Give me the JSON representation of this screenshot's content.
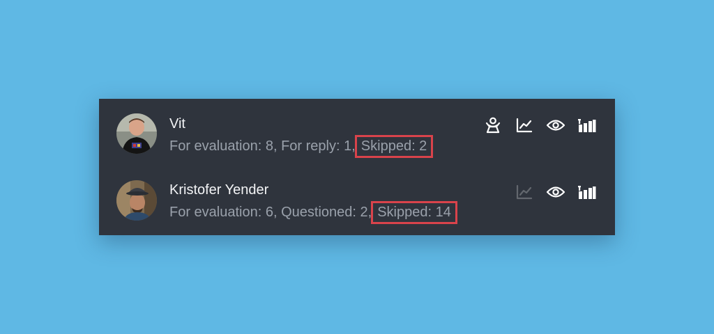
{
  "users": [
    {
      "name": "Vit",
      "stats_prefix": "For evaluation: 8, For reply: 1,",
      "skipped": "Skipped: 2",
      "icons": [
        "person-podium-icon",
        "line-chart-icon",
        "eye-icon",
        "bar-chart-icon"
      ]
    },
    {
      "name": "Kristofer Yender",
      "stats_prefix": "For evaluation: 6, Questioned: 2,",
      "skipped": "Skipped: 14",
      "icons": [
        "line-chart-icon-disabled",
        "eye-icon",
        "bar-chart-icon"
      ]
    }
  ],
  "colors": {
    "background": "#5fb8e4",
    "panel": "#2f343d",
    "highlight_border": "#d9434b",
    "name_text": "#f2f3f5",
    "stats_text": "#9aa1ab"
  }
}
